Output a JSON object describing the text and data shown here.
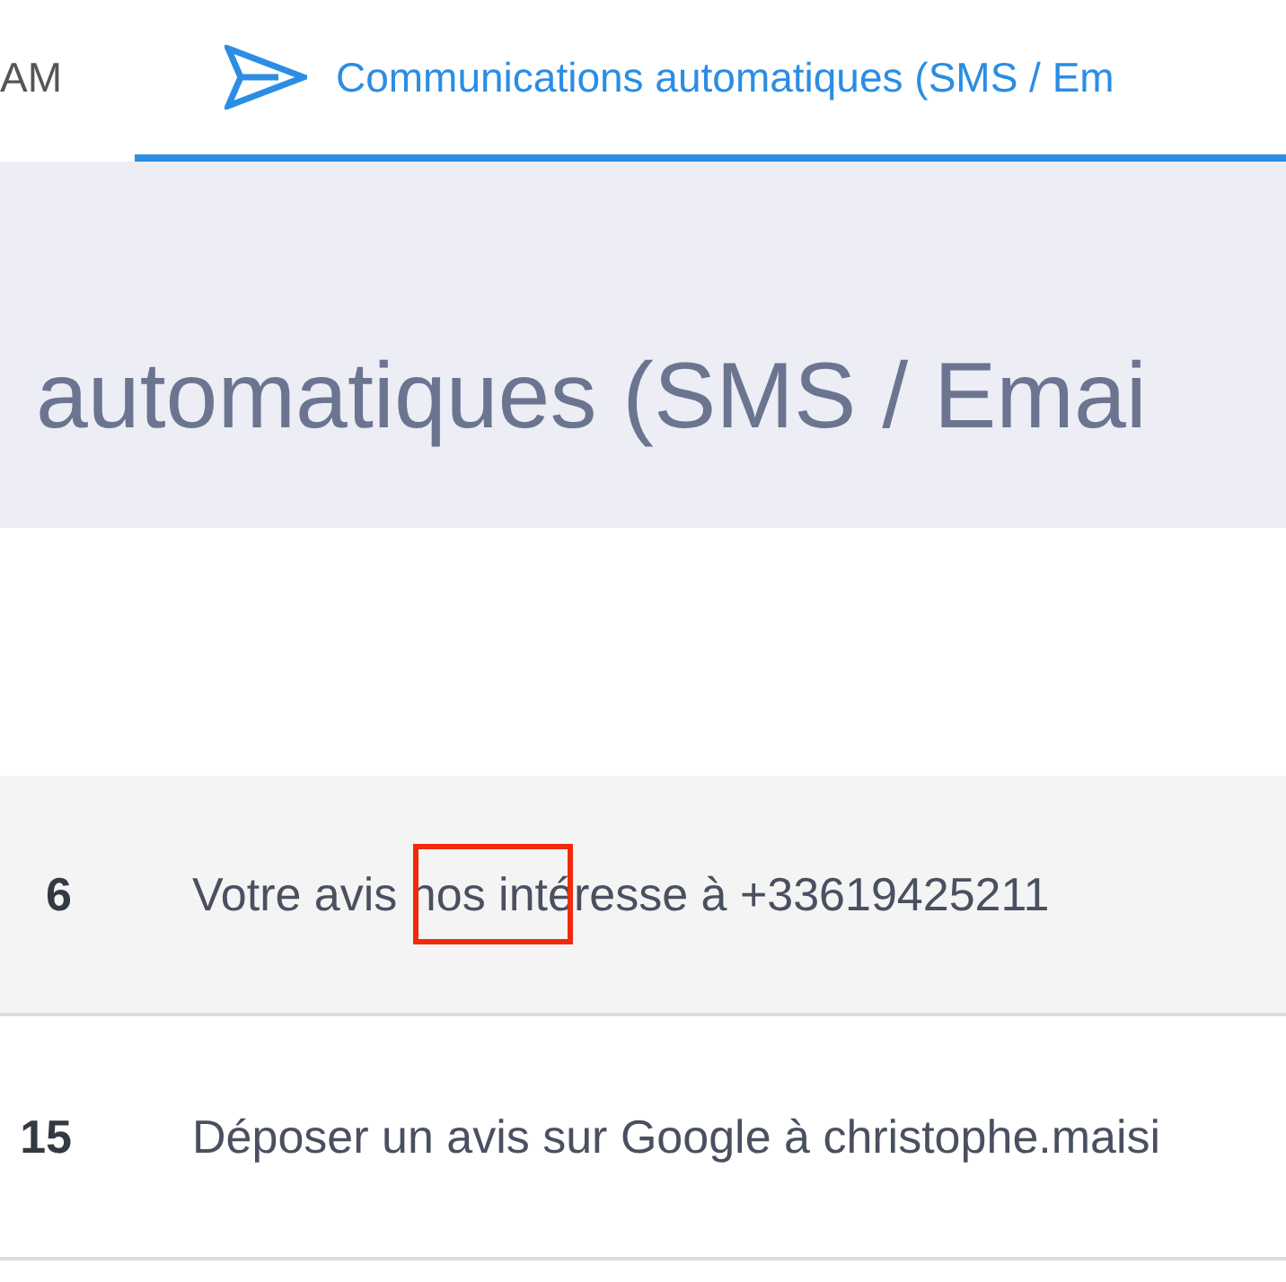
{
  "tabs": [
    {
      "label": "AM",
      "selected": false
    },
    {
      "label": "Communications automatiques (SMS / Em",
      "selected": true
    }
  ],
  "header": {
    "title": "automatiques (SMS / Emai"
  },
  "table": {
    "rows": [
      {
        "column_1": "6",
        "column_2": "Votre avis nos intéresse à +33619425211",
        "highlighted": true
      },
      {
        "column_1": "15",
        "column_2": "Déposer un avis sur Google à christophe.maisi",
        "highlighted": false
      }
    ]
  }
}
